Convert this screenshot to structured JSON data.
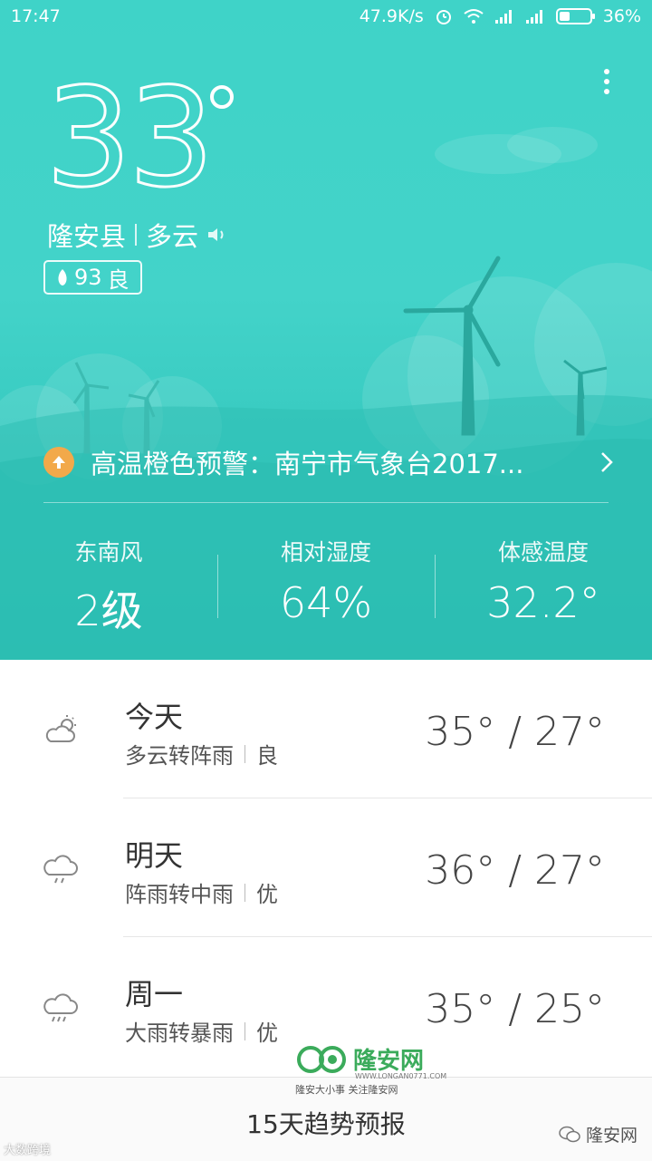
{
  "status_bar": {
    "time": "17:47",
    "speed": "47.9K/s",
    "battery": "36%",
    "battery_level": 0.36
  },
  "current": {
    "temperature": "33",
    "location": "隆安县",
    "condition": "多云",
    "aqi_value": "93",
    "aqi_label": "良"
  },
  "alert": {
    "text": "高温橙色预警：南宁市气象台2017..."
  },
  "stats": [
    {
      "label": "东南风",
      "value": "2级"
    },
    {
      "label": "相对湿度",
      "value": "64%"
    },
    {
      "label": "体感温度",
      "value": "32.2°"
    }
  ],
  "forecast": [
    {
      "day": "今天",
      "desc": "多云转阵雨",
      "aqi": "良",
      "range": "35° / 27°",
      "icon": "partly-cloudy-icon"
    },
    {
      "day": "明天",
      "desc": "阵雨转中雨",
      "aqi": "优",
      "range": "36° / 27°",
      "icon": "rain-icon"
    },
    {
      "day": "周一",
      "desc": "大雨转暴雨",
      "aqi": "优",
      "range": "35° / 25°",
      "icon": "heavy-rain-icon"
    }
  ],
  "bottom": {
    "label": "15天趋势预报"
  },
  "watermark": {
    "name": "隆安网",
    "url": "WWW.LONGAN0771.COM",
    "slogan": "隆安大小事 关注隆安网"
  },
  "corner": {
    "left": "大数跨境",
    "right": "隆安网"
  },
  "colors": {
    "sky_top": "#3fd3c8",
    "sky_bottom": "#2ec3b7",
    "alert_orange": "#f2a94a"
  }
}
